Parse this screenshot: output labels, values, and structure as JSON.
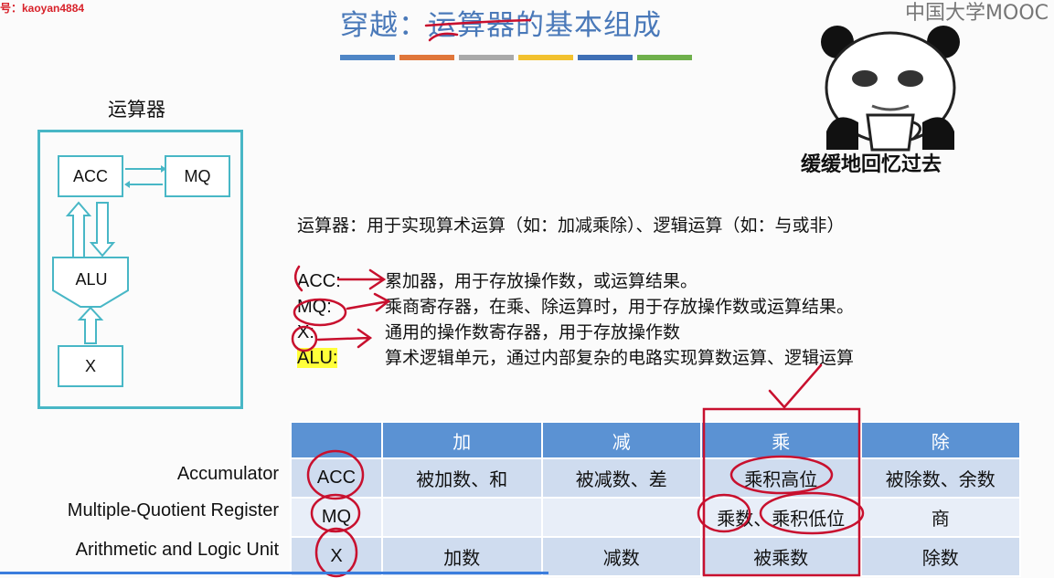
{
  "watermark": "号：kaoyan4884",
  "brand": "中国大学MOOC",
  "slide": {
    "title": "穿越：运算器的基本组成",
    "title_bar_colors": [
      "#4f86c6",
      "#e0763a",
      "#a9a9a9",
      "#f2c12e",
      "#3f6fb5",
      "#6fb04c"
    ]
  },
  "diagram": {
    "title": "运算器",
    "nodes": {
      "acc": "ACC",
      "mq": "MQ",
      "alu": "ALU",
      "x": "X"
    }
  },
  "meme": {
    "caption": "缓缓地回忆过去"
  },
  "description": "运算器：用于实现算术运算（如：加减乘除）、逻辑运算（如：与或非）",
  "definitions": [
    {
      "term": "ACC:",
      "text": "累加器，用于存放操作数，或运算结果。"
    },
    {
      "term": "MQ:",
      "text": "乘商寄存器，在乘、除运算时，用于存放操作数或运算结果。"
    },
    {
      "term": "X:",
      "text": "通用的操作数寄存器，用于存放操作数"
    },
    {
      "term": "ALU:",
      "text": "算术逻辑单元，通过内部复杂的电路实现算数运算、逻辑运算"
    }
  ],
  "row_labels": [
    "Accumulator",
    "Multiple-Quotient Register",
    "Arithmetic and Logic Unit"
  ],
  "table": {
    "headers": [
      "",
      "加",
      "减",
      "乘",
      "除"
    ],
    "rows": [
      [
        "ACC",
        "被加数、和",
        "被减数、差",
        "乘积高位",
        "被除数、余数"
      ],
      [
        "MQ",
        "",
        "",
        "乘数、乘积低位",
        "商"
      ],
      [
        "X",
        "加数",
        "减数",
        "被乘数",
        "除数"
      ]
    ]
  },
  "colors": {
    "accent": "#4a79b9",
    "ink": "#c8102e",
    "box": "#48b7c6",
    "header": "#5b92d3"
  }
}
